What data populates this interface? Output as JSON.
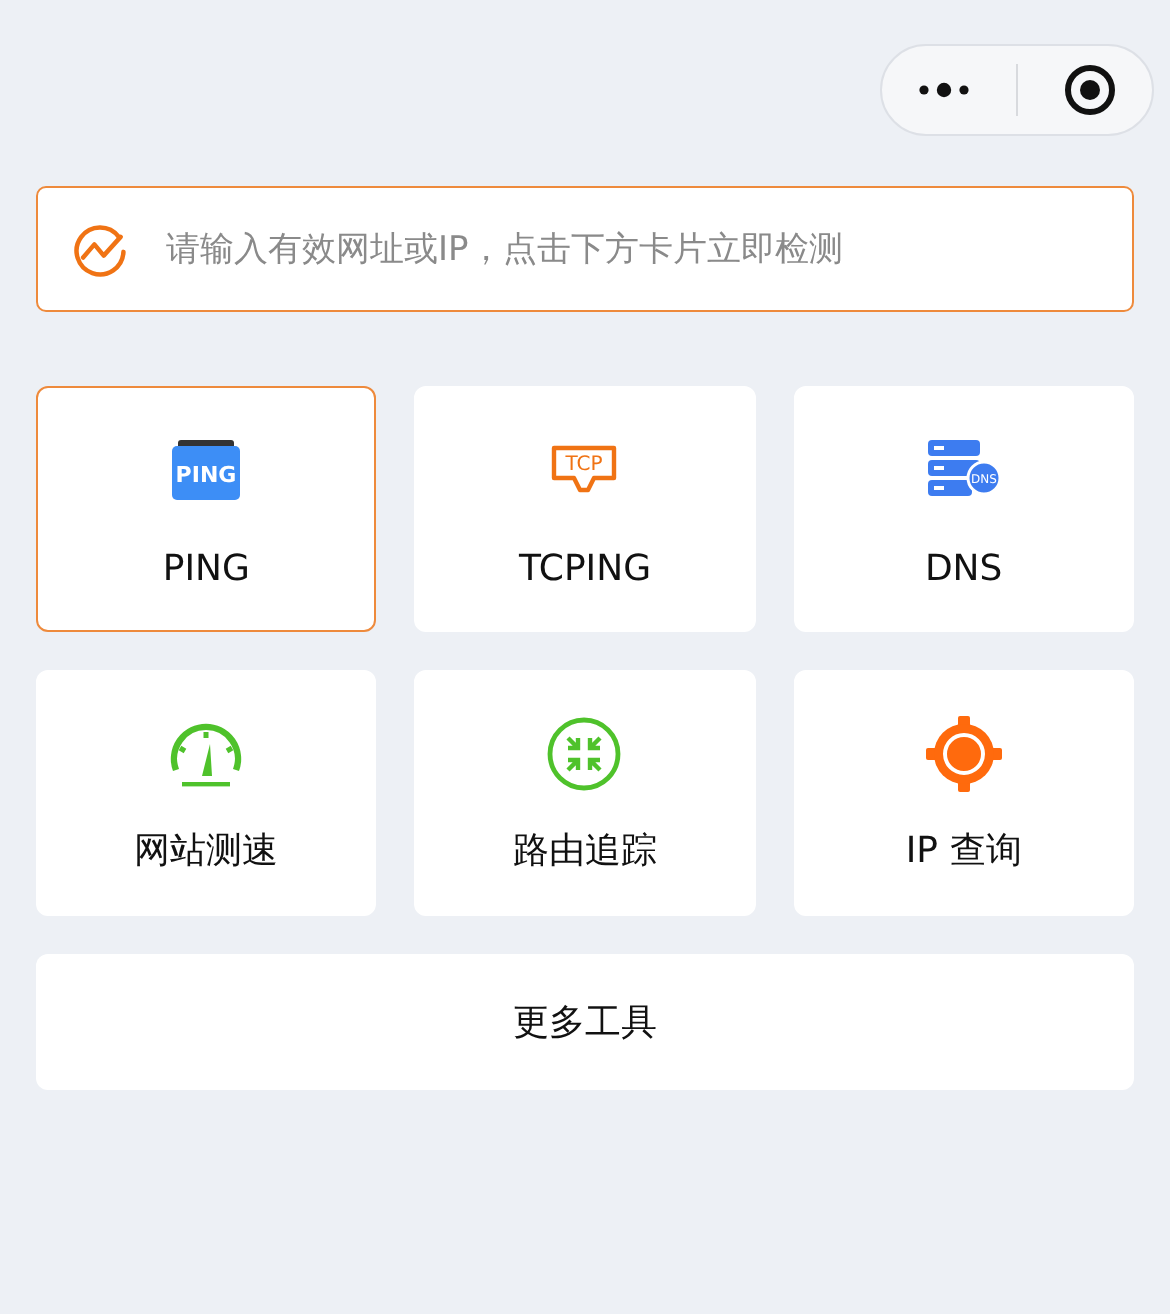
{
  "capsule": {
    "kind": "capsule"
  },
  "search": {
    "placeholder": "请输入有效网址或IP，点击下方卡片立即检测"
  },
  "tools": [
    {
      "label": "PING",
      "kind": "ping",
      "icon_text": "PING",
      "selected": true
    },
    {
      "label": "TCPING",
      "kind": "tcp",
      "icon_text": "TCP",
      "selected": false
    },
    {
      "label": "DNS",
      "kind": "dns",
      "icon_text": "DNS",
      "selected": false
    },
    {
      "label": "网站测速",
      "kind": "speed",
      "selected": false
    },
    {
      "label": "路由追踪",
      "kind": "route",
      "selected": false
    },
    {
      "label": "IP 查询",
      "kind": "ip",
      "selected": false
    }
  ],
  "more_button": "更多工具"
}
